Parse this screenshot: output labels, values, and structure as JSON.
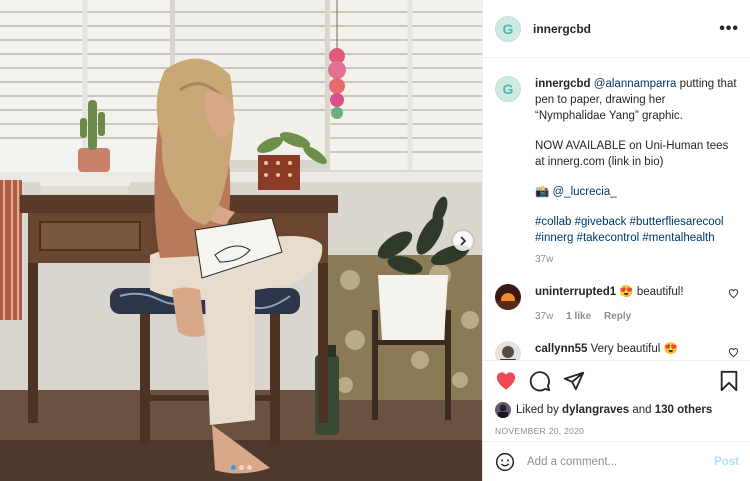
{
  "post": {
    "username": "innergcbd",
    "avatar_letter": "G",
    "more_icon": "more-options-icon"
  },
  "caption": {
    "username": "innergcbd",
    "mention": "@alannamparra",
    "text1": " putting that pen to paper, drawing her “Nymphalidae Yang” graphic.",
    "text2": "NOW AVAILABLE on Uni-Human tees at innerg.com (link in bio)",
    "camera_emoji": "📸",
    "photo_credit": "@_lucrecia_",
    "hashtags": "#collab #giveback #butterfliesarecool #innerg #takecontrol #mentalhealth",
    "time": "37w"
  },
  "comments": [
    {
      "username": "uninterrupted1",
      "text": " 😍 beautiful!",
      "time": "37w",
      "likes": "1 like",
      "reply": "Reply"
    },
    {
      "username": "callynn55",
      "text": " Very beautiful 😍"
    }
  ],
  "actions": {
    "liked_by_prefix": "Liked by ",
    "liked_by_user": "dylangraves",
    "liked_by_mid": " and ",
    "liked_by_others": "130 others",
    "date": "NOVEMBER 20, 2020"
  },
  "add_comment": {
    "placeholder": "Add a comment...",
    "post_label": "Post"
  },
  "colors": {
    "like_red": "#ed4956",
    "link_blue": "#00376b",
    "carousel_dot": "#3897f0",
    "post_disabled": "#b2dffc"
  },
  "carousel": {
    "slides": 3,
    "active": 1
  }
}
